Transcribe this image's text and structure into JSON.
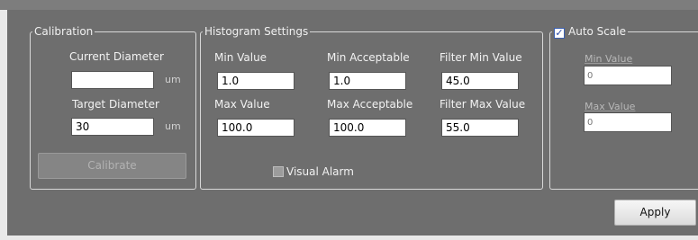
{
  "calibration": {
    "legend": "Calibration",
    "current_diameter_label": "Current Diameter",
    "current_diameter_value": "",
    "target_diameter_label": "Target Diameter",
    "target_diameter_value": "30",
    "unit": "um",
    "calibrate_label": "Calibrate"
  },
  "histogram": {
    "legend": "Histogram Settings",
    "min_value_label": "Min Value",
    "min_value": "1.0",
    "max_value_label": "Max Value",
    "max_value": "100.0",
    "min_acceptable_label": "Min Acceptable",
    "min_acceptable": "1.0",
    "max_acceptable_label": "Max Acceptable",
    "max_acceptable": "100.0",
    "filter_min_label": "Filter Min Value",
    "filter_min": "45.0",
    "filter_max_label": "Filter Max Value",
    "filter_max": "55.0",
    "visual_alarm_label": "Visual Alarm",
    "visual_alarm_checked": false
  },
  "auto_scale": {
    "legend": "Auto Scale",
    "checked": true,
    "min_value_label": "Min Value",
    "min_value": "0",
    "max_value_label": "Max Value",
    "max_value": "0"
  },
  "apply_label": "Apply",
  "icons": {
    "checkmark": "✓"
  },
  "colors": {
    "panel_bg": "#6e6e6e",
    "checkbox_accent": "#2447a8"
  }
}
